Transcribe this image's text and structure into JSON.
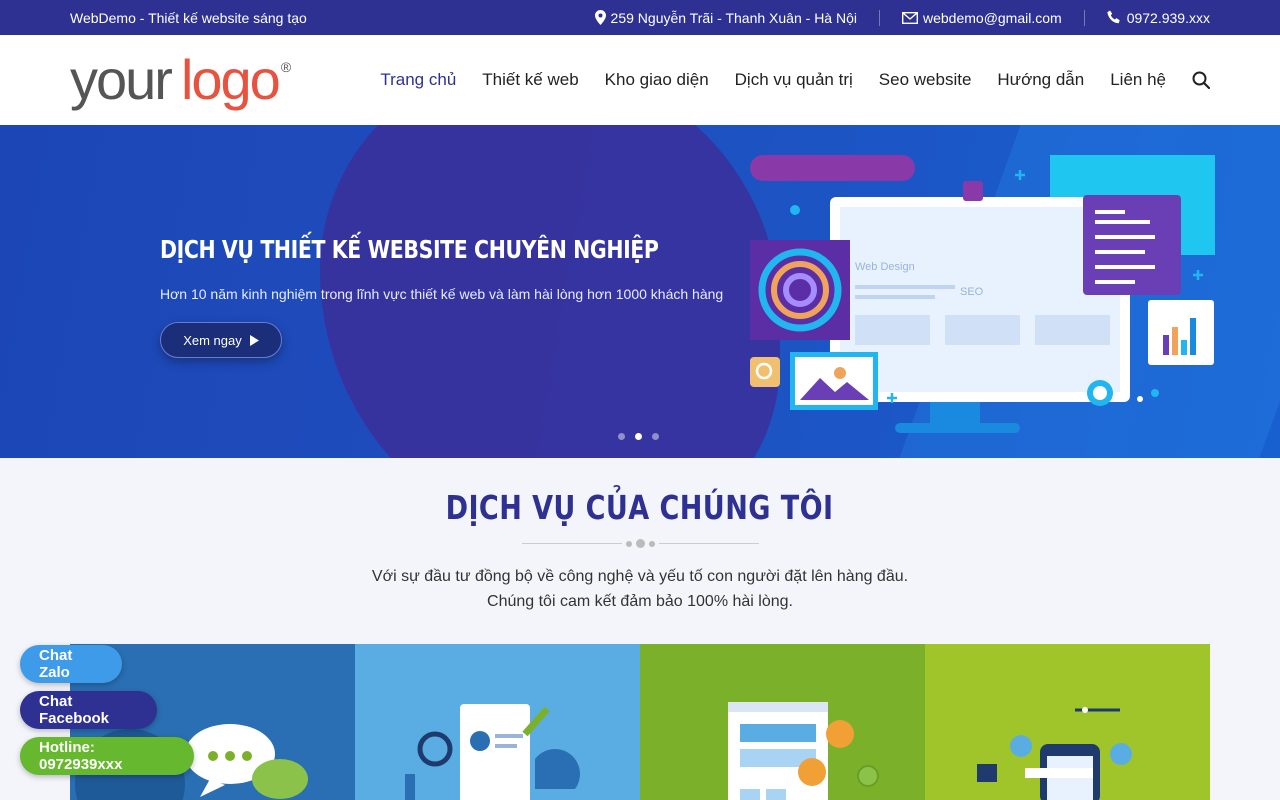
{
  "topbar": {
    "brand": "WebDemo - Thiết kế website sáng tạo",
    "address": "259 Nguyễn Trãi - Thanh Xuân - Hà Nội",
    "email": "webdemo@gmail.com",
    "phone": "0972.939.xxx"
  },
  "logo": {
    "part1": "your",
    "part2": "logo",
    "mark": "®"
  },
  "nav": {
    "items": [
      "Trang chủ",
      "Thiết kế web",
      "Kho giao diện",
      "Dịch vụ quản trị",
      "Seo website",
      "Hướng dẫn",
      "Liên hệ"
    ],
    "active_index": 0,
    "search_icon": "search-icon"
  },
  "hero": {
    "title": "DỊCH VỤ THIẾT KẾ WEBSITE CHUYÊN NGHIỆP",
    "subtitle": "Hơn 10 năm kinh nghiệm trong lĩnh vực thiết kế web và làm hài lòng hơn 1000 khách hàng",
    "button_label": "Xem ngay",
    "slides": 3,
    "active_slide": 2,
    "illustration": {
      "label_1": "Web Design",
      "label_2": "SEO"
    }
  },
  "services": {
    "title": "DỊCH VỤ CỦA CHÚNG TÔI",
    "desc_line1": "Với sự đầu tư đồng bộ về công nghệ và yếu tố con người đặt lên hàng đầu.",
    "desc_line2": "Chúng tôi cam kết đảm bảo 100% hài lòng."
  },
  "floating": {
    "zalo": "Chat Zalo",
    "facebook": "Chat Facebook",
    "hotline": "Hotline: 0972939xxx"
  },
  "colors": {
    "primary": "#2e3192",
    "accent": "#e8533f",
    "zalo": "#3d9be9",
    "hotline": "#66b82e"
  }
}
